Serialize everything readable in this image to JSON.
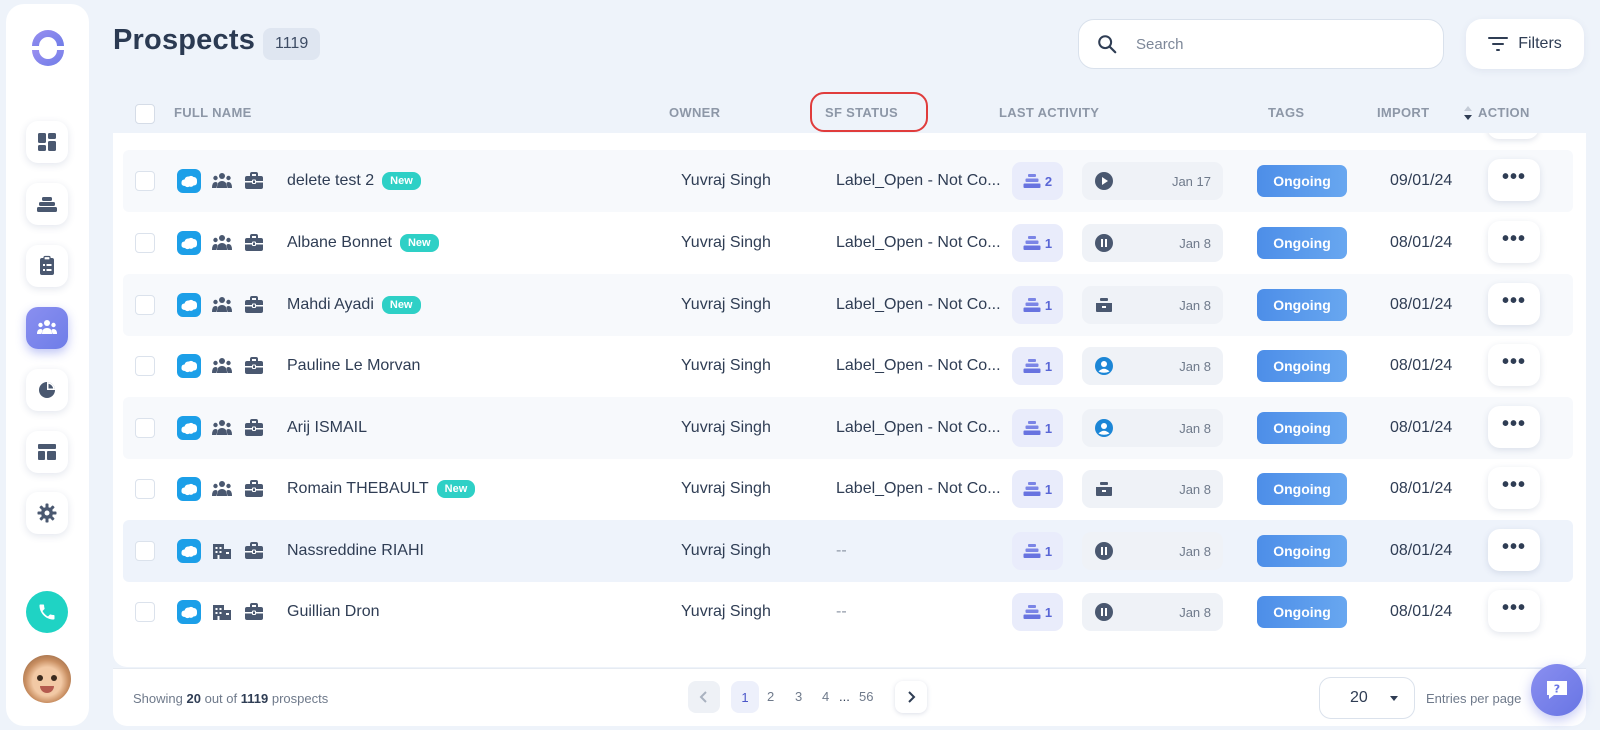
{
  "header": {
    "title": "Prospects",
    "count": "1119"
  },
  "search": {
    "placeholder": "Search",
    "value": ""
  },
  "filters": {
    "label": "Filters"
  },
  "columns": {
    "full_name": "FULL NAME",
    "owner": "OWNER",
    "sf_status": "SF STATUS",
    "last_activity": "LAST ACTIVITY",
    "tags": "TAGS",
    "import": "IMPORT",
    "action": "ACTION"
  },
  "sidebar": {
    "items": [
      {
        "name": "dashboard",
        "icon": "dashboard-icon",
        "active": false
      },
      {
        "name": "sequences",
        "icon": "layers-icon",
        "active": false
      },
      {
        "name": "tasks",
        "icon": "clipboard-icon",
        "active": false
      },
      {
        "name": "prospects",
        "icon": "people-icon",
        "active": true
      },
      {
        "name": "reports",
        "icon": "pie-chart-icon",
        "active": false
      },
      {
        "name": "templates",
        "icon": "layout-icon",
        "active": false
      },
      {
        "name": "settings",
        "icon": "gear-icon",
        "active": false
      }
    ]
  },
  "rows": [
    {
      "name": "delete test 2",
      "new": "New",
      "entity": "people",
      "owner": "Yuvraj Singh",
      "sf_status": "Label_Open - Not Co...",
      "seq": "2",
      "activity_icon": "play-icon",
      "date": "Jan 17",
      "tag": "Ongoing",
      "import": "09/01/24"
    },
    {
      "name": "Albane Bonnet",
      "new": "New",
      "entity": "people",
      "owner": "Yuvraj Singh",
      "sf_status": "Label_Open - Not Co...",
      "seq": "1",
      "activity_icon": "pause-icon",
      "date": "Jan 8",
      "tag": "Ongoing",
      "import": "08/01/24"
    },
    {
      "name": "Mahdi Ayadi",
      "new": "New",
      "entity": "people",
      "owner": "Yuvraj Singh",
      "sf_status": "Label_Open - Not Co...",
      "seq": "1",
      "activity_icon": "inbox-icon",
      "date": "Jan 8",
      "tag": "Ongoing",
      "import": "08/01/24"
    },
    {
      "name": "Pauline Le Morvan",
      "new": "",
      "entity": "people",
      "owner": "Yuvraj Singh",
      "sf_status": "Label_Open - Not Co...",
      "seq": "1",
      "activity_icon": "user-icon",
      "date": "Jan 8",
      "tag": "Ongoing",
      "import": "08/01/24"
    },
    {
      "name": "Arij ISMAIL",
      "new": "",
      "entity": "people",
      "owner": "Yuvraj Singh",
      "sf_status": "Label_Open - Not Co...",
      "seq": "1",
      "activity_icon": "user-icon",
      "date": "Jan 8",
      "tag": "Ongoing",
      "import": "08/01/24"
    },
    {
      "name": "Romain THEBAULT",
      "new": "New",
      "entity": "people",
      "owner": "Yuvraj Singh",
      "sf_status": "Label_Open - Not Co...",
      "seq": "1",
      "activity_icon": "inbox-icon",
      "date": "Jan 8",
      "tag": "Ongoing",
      "import": "08/01/24"
    },
    {
      "name": "Nassreddine RIAHI",
      "new": "",
      "entity": "building",
      "owner": "Yuvraj Singh",
      "sf_status": "--",
      "seq": "1",
      "activity_icon": "pause-icon",
      "date": "Jan 8",
      "tag": "Ongoing",
      "import": "08/01/24"
    },
    {
      "name": "Guillian Dron",
      "new": "",
      "entity": "building",
      "owner": "Yuvraj Singh",
      "sf_status": "--",
      "seq": "1",
      "activity_icon": "pause-icon",
      "date": "Jan 8",
      "tag": "Ongoing",
      "import": "08/01/24"
    }
  ],
  "footer": {
    "showing_prefix": "Showing",
    "showing_count": "20",
    "showing_mid": "out of",
    "showing_total": "1119",
    "showing_suffix": "prospects",
    "pages": [
      "1",
      "2",
      "3",
      "4"
    ],
    "ellipsis": "...",
    "last_page": "56",
    "per_page": "20",
    "per_page_label": "Entries per page"
  },
  "colors": {
    "accent": "#6e7de8",
    "salesforce": "#1c9fe8",
    "new_badge": "#2ed0c6",
    "tag": "#4d8ee8",
    "call": "#1fd3c4",
    "highlight": "#e03c3c"
  }
}
